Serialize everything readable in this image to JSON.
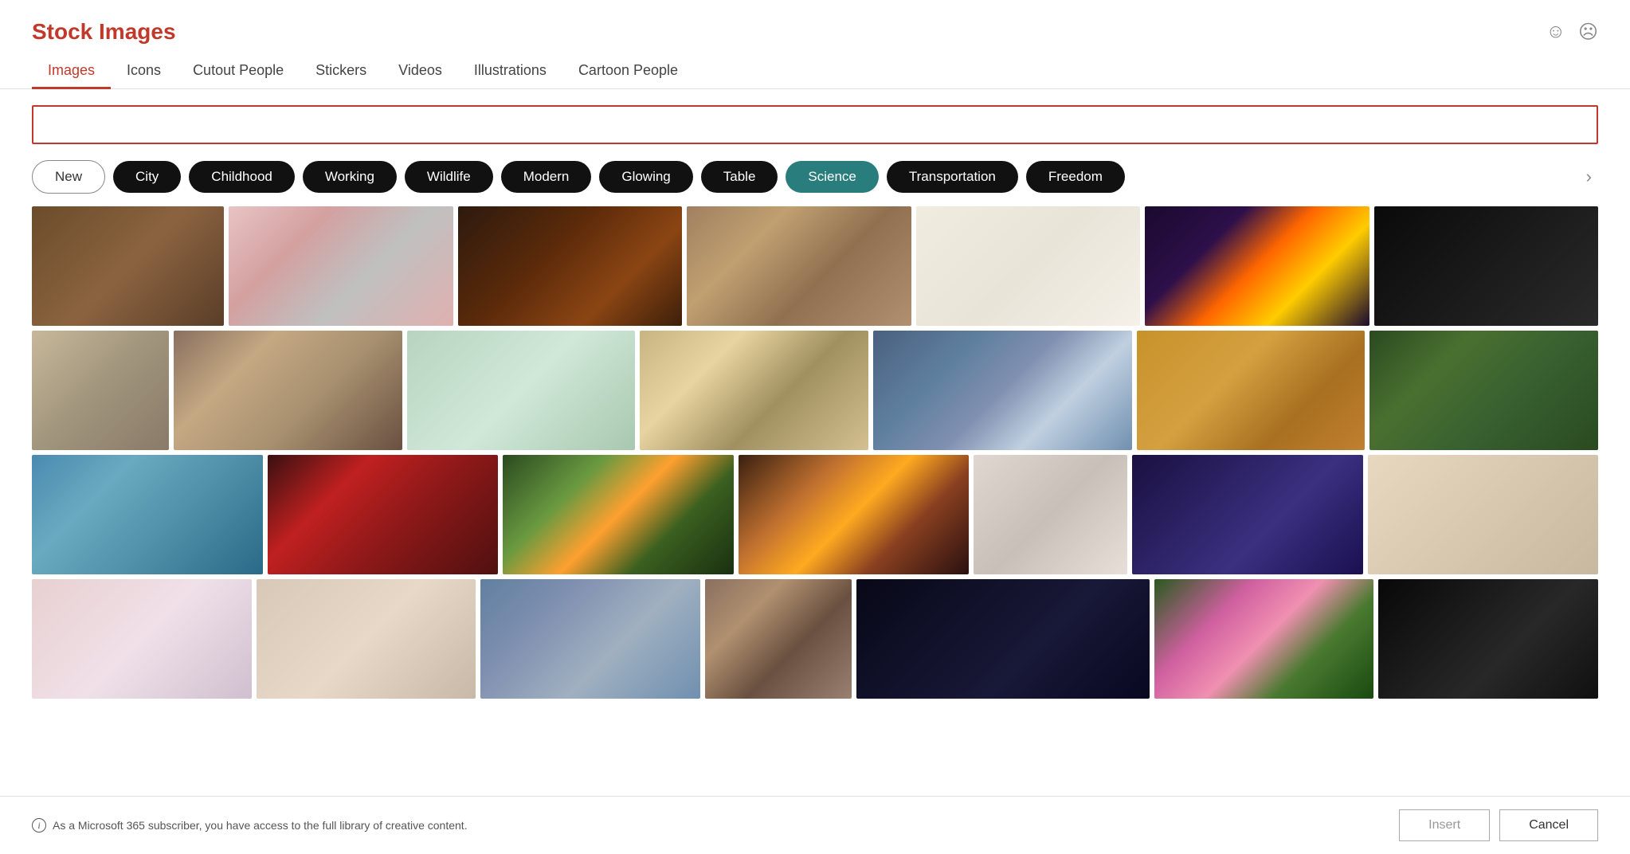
{
  "title": "Stock Images",
  "header": {
    "title": "Stock Images",
    "smile_icon": "☺",
    "frown_icon": "☹"
  },
  "tabs": [
    {
      "id": "images",
      "label": "Images",
      "active": true
    },
    {
      "id": "icons",
      "label": "Icons",
      "active": false
    },
    {
      "id": "cutout-people",
      "label": "Cutout People",
      "active": false
    },
    {
      "id": "stickers",
      "label": "Stickers",
      "active": false
    },
    {
      "id": "videos",
      "label": "Videos",
      "active": false
    },
    {
      "id": "illustrations",
      "label": "Illustrations",
      "active": false
    },
    {
      "id": "cartoon-people",
      "label": "Cartoon People",
      "active": false
    }
  ],
  "search": {
    "placeholder": ""
  },
  "filters": [
    {
      "id": "new",
      "label": "New",
      "style": "outline"
    },
    {
      "id": "city",
      "label": "City",
      "style": "dark"
    },
    {
      "id": "childhood",
      "label": "Childhood",
      "style": "dark"
    },
    {
      "id": "working",
      "label": "Working",
      "style": "dark"
    },
    {
      "id": "wildlife",
      "label": "Wildlife",
      "style": "dark"
    },
    {
      "id": "modern",
      "label": "Modern",
      "style": "dark"
    },
    {
      "id": "glowing",
      "label": "Glowing",
      "style": "dark"
    },
    {
      "id": "table",
      "label": "Table",
      "style": "dark"
    },
    {
      "id": "science",
      "label": "Science",
      "style": "teal"
    },
    {
      "id": "transportation",
      "label": "Transportation",
      "style": "dark"
    },
    {
      "id": "freedom",
      "label": "Freedom",
      "style": "dark"
    }
  ],
  "footer": {
    "info_text": "As a Microsoft 365 subscriber, you have access to the full library of creative content.",
    "insert_label": "Insert",
    "cancel_label": "Cancel"
  }
}
